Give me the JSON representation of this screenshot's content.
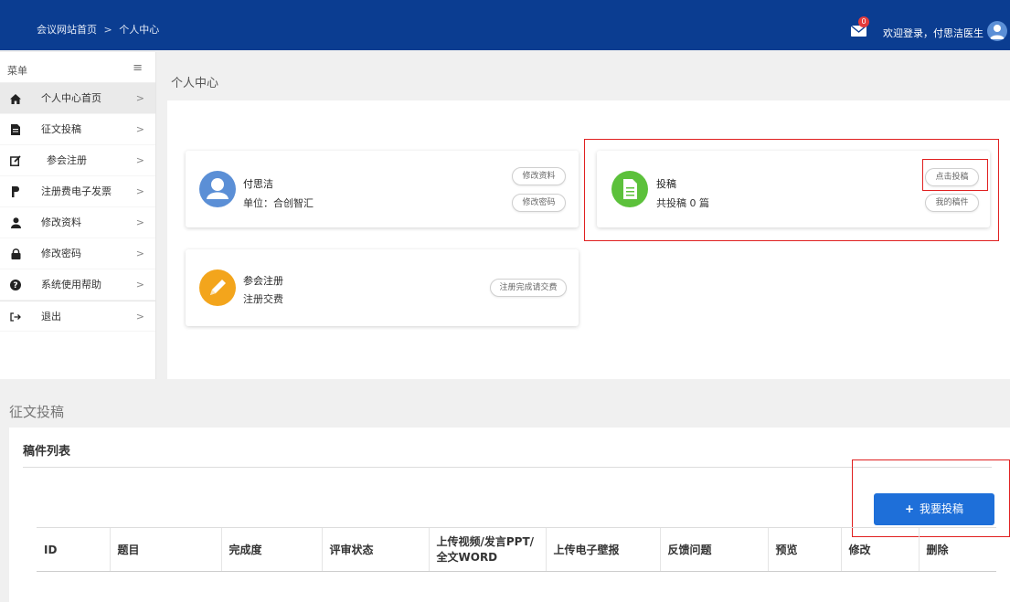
{
  "header": {
    "breadcrumb_home": "会议网站首页",
    "breadcrumb_sep": ">",
    "breadcrumb_current": "个人中心",
    "badge_count": "0",
    "welcome": "欢迎登录，付思洁医生"
  },
  "sidebar": {
    "title": "菜单",
    "toggle": "≡",
    "items": [
      {
        "label": "个人中心首页",
        "icon": "home-icon"
      },
      {
        "label": "征文投稿",
        "icon": "document-icon"
      },
      {
        "label": "参会注册",
        "icon": "edit-icon"
      },
      {
        "label": "注册费电子发票",
        "icon": "yen-icon"
      },
      {
        "label": "修改资料",
        "icon": "user-icon"
      },
      {
        "label": "修改密码",
        "icon": "lock-icon"
      },
      {
        "label": "系统使用帮助",
        "icon": "help-icon"
      },
      {
        "label": "退出",
        "icon": "logout-icon"
      }
    ],
    "chevron": ">"
  },
  "main": {
    "title": "个人中心",
    "profile_card": {
      "name": "付思洁",
      "unit": "单位：合创智汇",
      "edit_profile_btn": "修改资料",
      "edit_password_btn": "修改密码"
    },
    "submission_card": {
      "title": "投稿",
      "count_text": "共投稿 0 篇",
      "submit_btn": "点击投稿",
      "my_manuscripts_btn": "我的稿件"
    },
    "registration_card": {
      "title": "参会注册",
      "subtitle": "注册交费",
      "action_btn": "注册完成请交费"
    }
  },
  "lower": {
    "section_title": "征文投稿",
    "list_title": "稿件列表",
    "add_button": "我要投稿",
    "plus": "+",
    "columns": [
      "ID",
      "题目",
      "完成度",
      "评审状态",
      "上传视频/发言PPT/全文WORD",
      "上传电子壁报",
      "反馈问题",
      "预览",
      "修改",
      "删除"
    ]
  },
  "colors": {
    "header_bg": "#0b3d91",
    "primary_button": "#1e6fd9",
    "highlight_border": "#e02020",
    "profile_icon": "#5b8fd6",
    "submission_icon": "#5cc13b",
    "registration_icon": "#f3a51c"
  }
}
